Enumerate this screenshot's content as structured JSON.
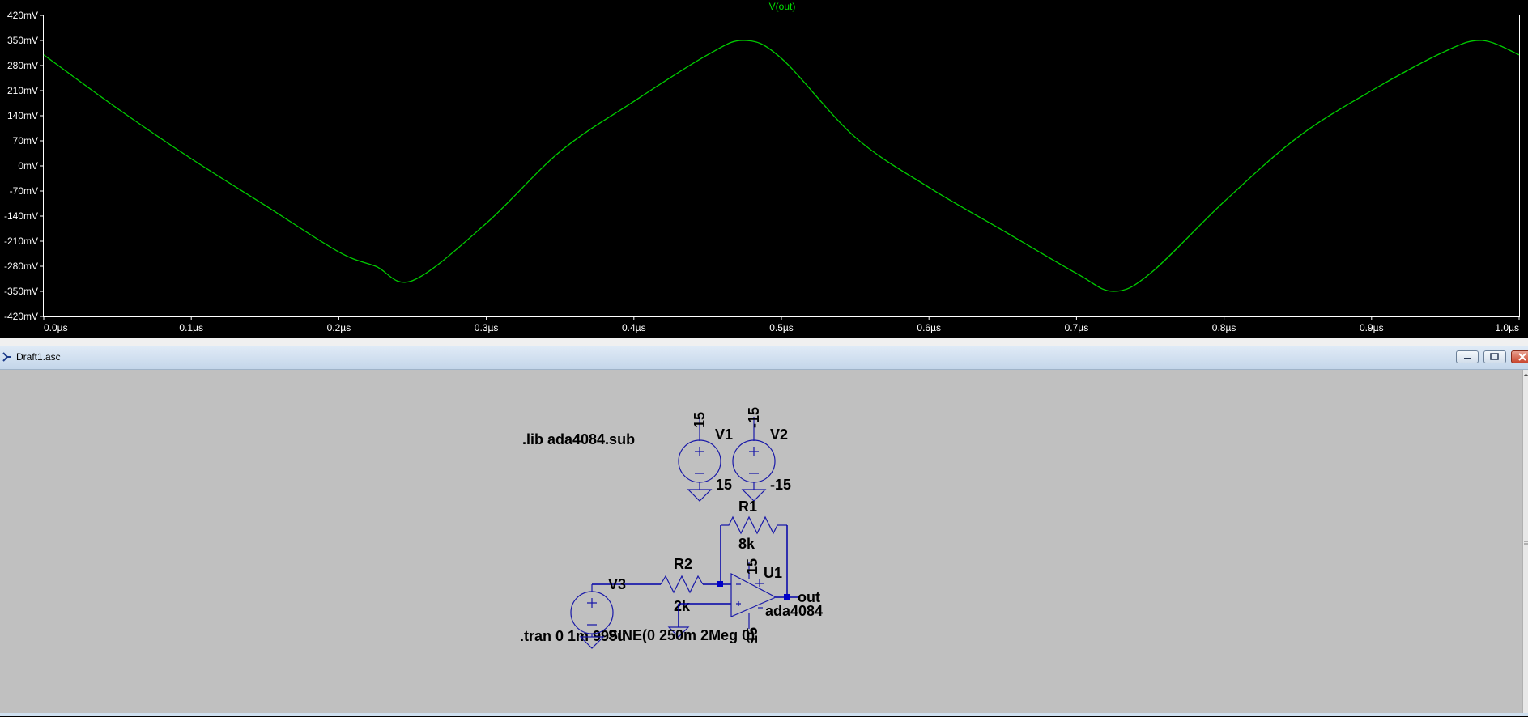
{
  "plot": {
    "trace_title": "V(out)",
    "y_ticks": [
      "420mV",
      "350mV",
      "280mV",
      "210mV",
      "140mV",
      "70mV",
      "0mV",
      "-70mV",
      "-140mV",
      "-210mV",
      "-280mV",
      "-350mV",
      "-420mV"
    ],
    "x_ticks": [
      "0.0µs",
      "0.1µs",
      "0.2µs",
      "0.3µs",
      "0.4µs",
      "0.5µs",
      "0.6µs",
      "0.7µs",
      "0.8µs",
      "0.9µs",
      "1.0µs"
    ],
    "trace_color": "#00cc00",
    "grid": false
  },
  "chart_data": {
    "type": "line",
    "title": "V(out)",
    "xlabel": "",
    "ylabel": "",
    "x_unit": "µs",
    "y_unit": "mV",
    "xlim": [
      0,
      1.0
    ],
    "ylim": [
      -420,
      420
    ],
    "series": [
      {
        "name": "V(out)",
        "x": [
          0.0,
          0.05,
          0.1,
          0.15,
          0.2,
          0.225,
          0.25,
          0.3,
          0.35,
          0.4,
          0.45,
          0.475,
          0.5,
          0.55,
          0.6,
          0.65,
          0.7,
          0.725,
          0.75,
          0.8,
          0.85,
          0.9,
          0.95,
          0.975,
          1.0
        ],
        "y": [
          310,
          160,
          20,
          -110,
          -240,
          -280,
          -320,
          -160,
          40,
          180,
          310,
          350,
          300,
          80,
          -60,
          -180,
          -300,
          -350,
          -300,
          -100,
          80,
          210,
          320,
          350,
          310
        ]
      }
    ]
  },
  "window": {
    "title": "Draft1.asc"
  },
  "schematic": {
    "directive_lib": ".lib ada4084.sub",
    "directive_tran": ".tran 0 1m 999u",
    "v1_name": "V1",
    "v1_value": "15",
    "v1_node": "15",
    "v2_name": "V2",
    "v2_value": "-15",
    "v2_node": "-15",
    "r1_name": "R1",
    "r1_value": "8k",
    "r2_name": "R2",
    "r2_value": "2k",
    "v3_name": "V3",
    "v3_value": "SINE(0 250m 2Meg 0)",
    "u1_name": "U1",
    "u1_value": "ada4084",
    "u1_vpos": "15",
    "u1_vneg": "15",
    "out_label": "out"
  }
}
